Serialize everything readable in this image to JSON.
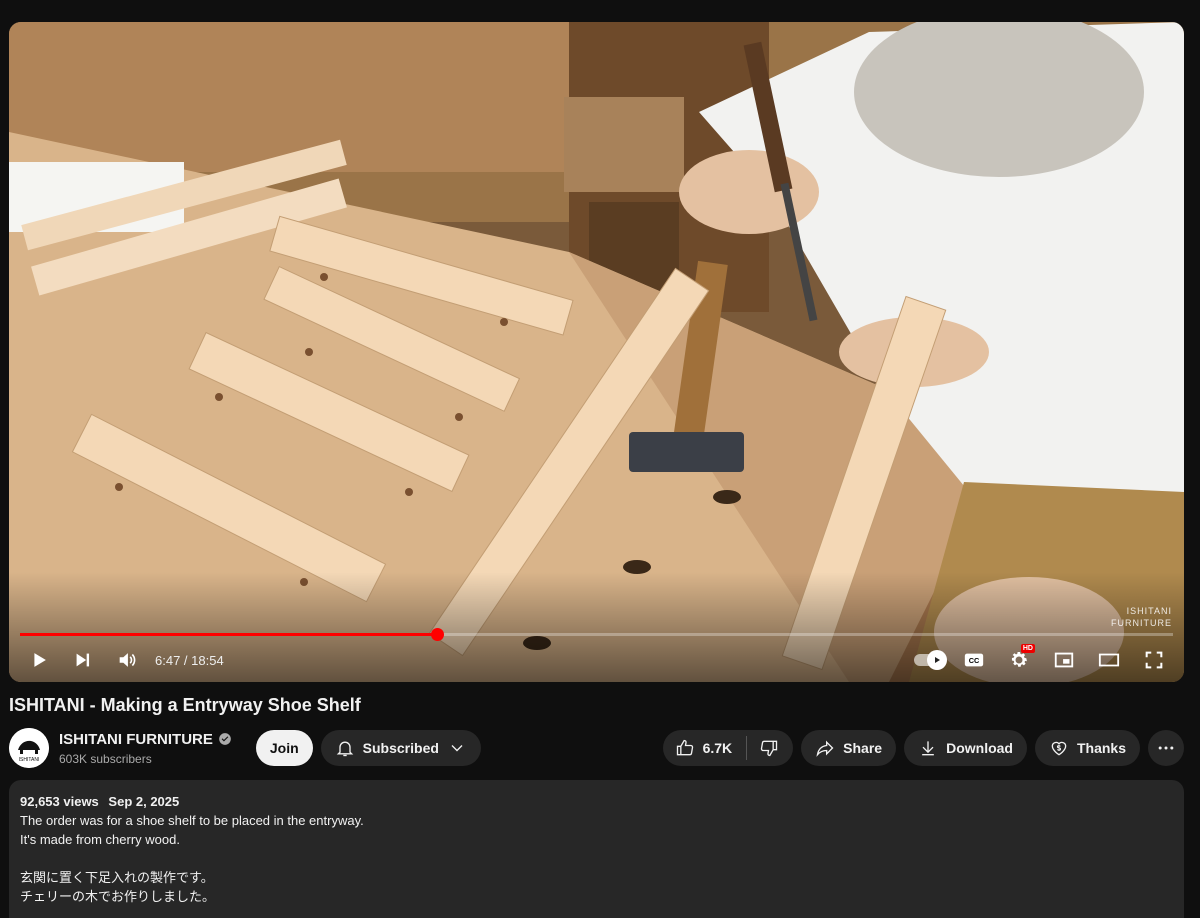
{
  "player": {
    "watermark": [
      "ISHITANI",
      "FURNITURE"
    ],
    "time_display": "6:47 / 18:54",
    "progress_fraction": 0.362,
    "icons": [
      "play-icon",
      "next-icon",
      "volume-icon",
      "autoplay-toggle-icon",
      "captions-icon",
      "settings-icon",
      "miniplayer-icon",
      "theater-icon",
      "fullscreen-icon"
    ],
    "hd_badge": "HD",
    "cc_label": "CC"
  },
  "video": {
    "title": "ISHITANI - Making a Entryway Shoe Shelf"
  },
  "channel": {
    "name": "ISHITANI FURNITURE",
    "subscribers": "603K subscribers",
    "avatar_text": "ISHITANI",
    "join_label": "Join",
    "subscribed_label": "Subscribed"
  },
  "actions": {
    "like_count": "6.7K",
    "share_label": "Share",
    "download_label": "Download",
    "thanks_label": "Thanks"
  },
  "description": {
    "views": "92,653 views",
    "date": "Sep 2, 2025",
    "lines_en": [
      "The order was for a shoe shelf to be placed in the entryway.",
      "It's made from cherry wood."
    ],
    "lines_ja": [
      "玄関に置く下足入れの製作です。",
      "チェリーの木でお作りしました。"
    ]
  },
  "colors": {
    "background": "#0f0f0f",
    "pill": "#272727",
    "progress_red": "#ff0000",
    "text": "#f1f1f1",
    "secondary_text": "#aaaaaa"
  }
}
